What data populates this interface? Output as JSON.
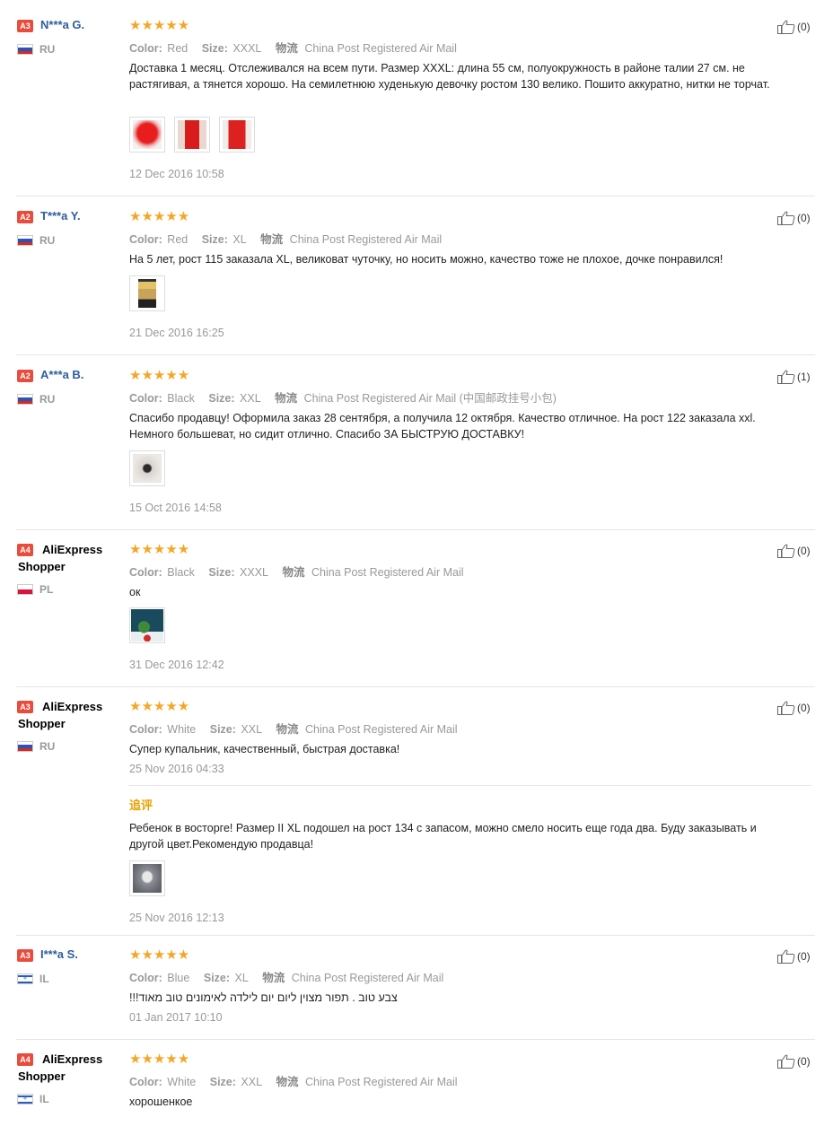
{
  "labels": {
    "color": "Color:",
    "size": "Size:",
    "shipping": "物流"
  },
  "colors": {
    "star": "#f5a623",
    "badge": "#e84c3d",
    "name": "#2c5e9e",
    "additional": "#e8a300"
  },
  "reviews": [
    {
      "level": "A3",
      "name": "N***a G.",
      "country": "RU",
      "stars": "★★★★★",
      "color": "Red",
      "size": "XXXL",
      "shipping": "China Post Registered Air Mail",
      "text": "Доставка 1 месяц. Отслеживался на всем пути. Размер XXXL: длина 55 см, полуокружность в районе талии 27 см. не растягивая, а тянется хорошо. На семилетнюю худенькую девочку ростом 130 велико. Пошито аккуратно, нитки не торчат.",
      "date": "12 Dec 2016 10:58",
      "likes": "(0)",
      "like_icon": "thumbs-up-icon"
    },
    {
      "level": "A2",
      "name": "T***a Y.",
      "country": "RU",
      "stars": "★★★★★",
      "color": "Red",
      "size": "XL",
      "shipping": "China Post Registered Air Mail",
      "text": "На 5 лет, рост 115 заказала XL, великоват чуточку, но носить можно, качество тоже не плохое, дочке понравился!",
      "date": "21 Dec 2016 16:25",
      "likes": "(0)"
    },
    {
      "level": "A2",
      "name": "A***a B.",
      "country": "RU",
      "stars": "★★★★★",
      "color": "Black",
      "size": "XXL",
      "shipping": "China Post Registered Air Mail (中国邮政挂号小包)",
      "text": "Спасибо продавцу! Оформила заказ 28 сентября, а получила 12 октября. Качество отличное. На рост 122 заказала xxl. Немного большеват, но сидит отлично. Спасибо ЗА БЫСТРУЮ ДОСТАВКУ!",
      "date": "15 Oct 2016 14:58",
      "likes": "(1)"
    },
    {
      "level": "A4",
      "name_line1": "AliExpress",
      "name_line2": "Shopper",
      "country": "PL",
      "stars": "★★★★★",
      "color": "Black",
      "size": "XXXL",
      "shipping": "China Post Registered Air Mail",
      "text": "ок",
      "date": "31 Dec 2016 12:42",
      "likes": "(0)"
    },
    {
      "level": "A3",
      "name_line1": "AliExpress",
      "name_line2": "Shopper",
      "country": "RU",
      "stars": "★★★★★",
      "color": "White",
      "size": "XXL",
      "shipping": "China Post Registered Air Mail",
      "text": "Супер купальник, качественный, быстрая доставка!",
      "date": "25 Nov 2016 04:33",
      "likes": "(0)",
      "additional_label": "追评",
      "additional_text": "Ребенок в восторге! Размер II XL подошел на рост 134 с запасом, можно смело носить еще года два. Буду заказывать и другой цвет.Рекомендую продавца!",
      "additional_date": "25 Nov 2016 12:13"
    },
    {
      "level": "A3",
      "name": "I***a S.",
      "country": "IL",
      "stars": "★★★★★",
      "color": "Blue",
      "size": "XL",
      "shipping": "China Post Registered Air Mail",
      "text": "צבע טוב . תפור מצוין ליום יום לילדה לאימונים טוב מאוד!!!",
      "date": "01 Jan 2017 10:10",
      "likes": "(0)"
    },
    {
      "level": "A4",
      "name_line1": "AliExpress",
      "name_line2": "Shopper",
      "country": "IL",
      "stars": "★★★★★",
      "color": "White",
      "size": "XXL",
      "shipping": "China Post Registered Air Mail",
      "text": "хорошенкое",
      "likes": "(0)"
    }
  ]
}
